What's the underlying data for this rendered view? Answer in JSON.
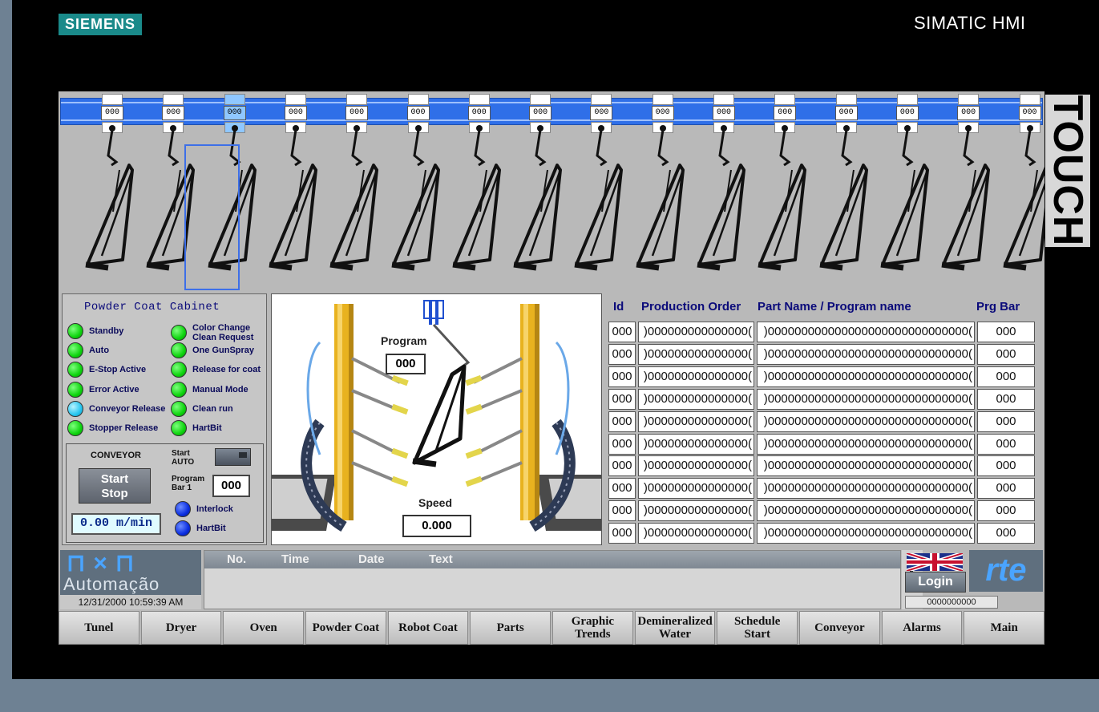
{
  "device": {
    "brand": "SIEMENS",
    "model": "SIMATIC HMI",
    "side_label": "TOUCH"
  },
  "conveyor": {
    "carrier_ids": [
      "000",
      "000",
      "000",
      "000",
      "000",
      "000",
      "000",
      "000",
      "000",
      "000",
      "000",
      "000",
      "000",
      "000",
      "000",
      "000"
    ],
    "selected_index": 2,
    "colors": {
      "rail": "#2f6fe8",
      "selected": "#8fc7ff"
    }
  },
  "cabinet": {
    "title": "Powder Coat Cabinet",
    "indicators_left": [
      {
        "label": "Standby",
        "color": "green"
      },
      {
        "label": "Auto",
        "color": "green"
      },
      {
        "label": "E-Stop Active",
        "color": "green"
      },
      {
        "label": "Error Active",
        "color": "green"
      },
      {
        "label": "Conveyor Release",
        "color": "cyan"
      },
      {
        "label": "Stopper Release",
        "color": "green"
      }
    ],
    "indicators_right": [
      {
        "label": "Color Change Clean Request",
        "color": "green"
      },
      {
        "label": "One GunSpray",
        "color": "green"
      },
      {
        "label": "Release for coat",
        "color": "green"
      },
      {
        "label": "Manual Mode",
        "color": "green"
      },
      {
        "label": "Clean run",
        "color": "green"
      },
      {
        "label": "HartBit",
        "color": "green"
      }
    ]
  },
  "conveyor_box": {
    "title": "CONVEYOR",
    "start_stop_label_1": "Start",
    "start_stop_label_2": "Stop",
    "speed": "0.00 m/min",
    "start_auto_label_1": "Start",
    "start_auto_label_2": "AUTO",
    "program_bar_label_1": "Program",
    "program_bar_label_2": "Bar 1",
    "program_bar_value": "000",
    "interlock_label": "Interlock",
    "hartbit_label": "HartBit"
  },
  "booth": {
    "program_label": "Program",
    "program_value": "000",
    "speed_label": "Speed",
    "speed_value": "0.000"
  },
  "production_table": {
    "headers": {
      "id": "Id",
      "order": "Production Order",
      "part": "Part Name / Program name",
      "bar": "Prg Bar"
    },
    "rows": [
      {
        "id": "000",
        "order": ")000000000000000(",
        "part": ")000000000000000000000000000000(",
        "bar": "000"
      },
      {
        "id": "000",
        "order": ")000000000000000(",
        "part": ")000000000000000000000000000000(",
        "bar": "000"
      },
      {
        "id": "000",
        "order": ")000000000000000(",
        "part": ")000000000000000000000000000000(",
        "bar": "000"
      },
      {
        "id": "000",
        "order": ")000000000000000(",
        "part": ")000000000000000000000000000000(",
        "bar": "000"
      },
      {
        "id": "000",
        "order": ")000000000000000(",
        "part": ")000000000000000000000000000000(",
        "bar": "000"
      },
      {
        "id": "000",
        "order": ")000000000000000(",
        "part": ")000000000000000000000000000000(",
        "bar": "000"
      },
      {
        "id": "000",
        "order": ")000000000000000(",
        "part": ")000000000000000000000000000000(",
        "bar": "000"
      },
      {
        "id": "000",
        "order": ")000000000000000(",
        "part": ")000000000000000000000000000000(",
        "bar": "000"
      },
      {
        "id": "000",
        "order": ")000000000000000(",
        "part": ")000000000000000000000000000000(",
        "bar": "000"
      },
      {
        "id": "000",
        "order": ")000000000000000(",
        "part": ")000000000000000000000000000000(",
        "bar": "000"
      }
    ]
  },
  "branding": {
    "company_top": "⊓×⊓",
    "company_bottom": "Automação",
    "partner": "rte"
  },
  "datetime": "12/31/2000 10:59:39 AM",
  "alarm_view": {
    "headers": [
      "No.",
      "Time",
      "Date",
      "Text"
    ]
  },
  "login": {
    "label": "Login",
    "user_field": "0000000000",
    "flag_icon": "uk-flag-icon"
  },
  "nav": [
    {
      "label": "Tunel"
    },
    {
      "label": "Dryer"
    },
    {
      "label": "Oven"
    },
    {
      "label": "Powder Coat"
    },
    {
      "label": "Robot Coat"
    },
    {
      "label": "Parts"
    },
    {
      "label": "Graphic Trends"
    },
    {
      "label": "Demineralized Water"
    },
    {
      "label": "Schedule Start"
    },
    {
      "label": "Conveyor"
    },
    {
      "label": "Alarms"
    },
    {
      "label": "Main"
    }
  ]
}
